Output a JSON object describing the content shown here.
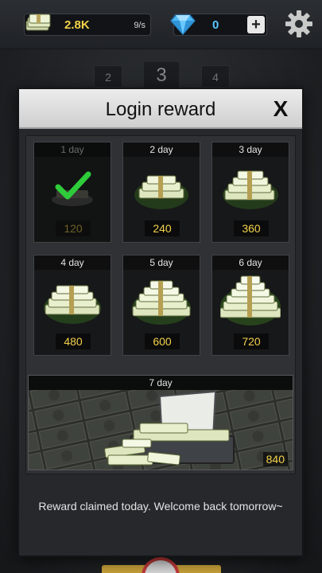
{
  "hud": {
    "money": "2.8K",
    "money_rate": "9/s",
    "gems": "0",
    "plus_label": "+"
  },
  "stage": {
    "prev": "2",
    "current": "3",
    "next": "4"
  },
  "modal": {
    "title": "Login reward",
    "close_label": "X",
    "days": [
      {
        "label": "1 day",
        "value": "120",
        "claimed": true
      },
      {
        "label": "2 day",
        "value": "240",
        "claimed": false
      },
      {
        "label": "3 day",
        "value": "360",
        "claimed": false
      },
      {
        "label": "4 day",
        "value": "480",
        "claimed": false
      },
      {
        "label": "5 day",
        "value": "600",
        "claimed": false
      },
      {
        "label": "6 day",
        "value": "720",
        "claimed": false
      }
    ],
    "big_day": {
      "label": "7 day",
      "value": "840"
    },
    "message": "Reward claimed today. Welcome back tomorrow~"
  },
  "colors": {
    "money": "#f2d14a",
    "gem": "#59c4ff",
    "check": "#2ecc3a"
  },
  "icons": {
    "money": "cash-stack-icon",
    "gem": "diamond-icon",
    "settings": "gear-icon",
    "claimed": "checkmark-icon"
  }
}
